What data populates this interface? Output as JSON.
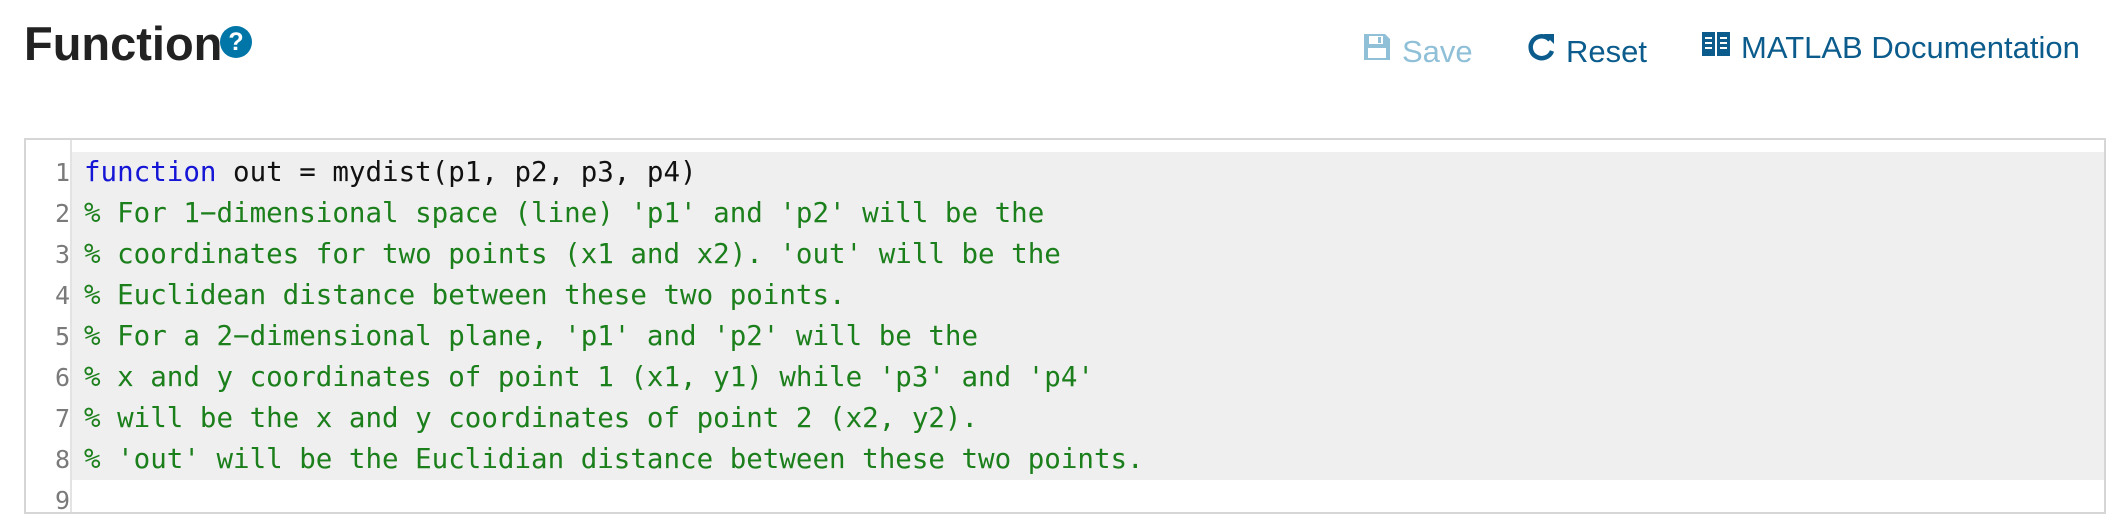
{
  "header": {
    "title": "Function",
    "help_icon": "question-circle-icon",
    "help_glyph": "?"
  },
  "toolbar": {
    "save_label": "Save",
    "save_state": "disabled",
    "reset_label": "Reset",
    "doc_label": "MATLAB Documentation"
  },
  "editor": {
    "line_numbers": [
      "1",
      "2",
      "3",
      "4",
      "5",
      "6",
      "7",
      "8",
      "9"
    ],
    "lines": [
      {
        "keyword": "function",
        "text": " out = mydist(p1, p2, p3, p4)"
      },
      {
        "comment": "% For 1−dimensional space (line) 'p1' and 'p2' will be the"
      },
      {
        "comment": "% coordinates for two points (x1 and x2). 'out' will be the"
      },
      {
        "comment": "% Euclidean distance between these two points."
      },
      {
        "comment": "% For a 2−dimensional plane, 'p1' and 'p2' will be the"
      },
      {
        "comment": "% x and y coordinates of point 1 (x1, y1) while 'p3' and 'p4'"
      },
      {
        "comment": "% will be the x and y coordinates of point 2 (x2, y2)."
      },
      {
        "comment": "% 'out' will be the Euclidian distance between these two points."
      },
      {
        "text": ""
      }
    ]
  },
  "colors": {
    "accent": "#0076a8",
    "link": "#0b5c8c",
    "disabled": "#8fc0d8",
    "keyword": "#1515d6",
    "comment": "#1b7f1b",
    "line_highlight": "#efefef"
  }
}
